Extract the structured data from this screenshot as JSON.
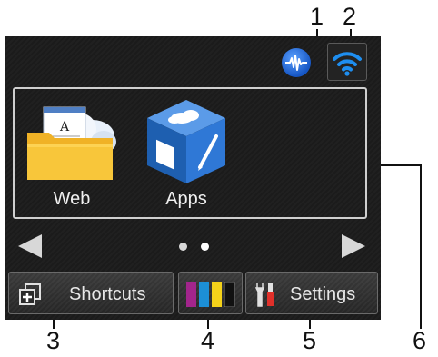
{
  "callouts": [
    "1",
    "2",
    "3",
    "4",
    "5",
    "6"
  ],
  "status_bar": {
    "wired_icon": "wired-lan-icon",
    "wifi_icon": "wifi-icon"
  },
  "apps": [
    {
      "label": "Web",
      "icon": "web-folder-cloud-icon"
    },
    {
      "label": "Apps",
      "icon": "apps-cube-icon"
    }
  ],
  "pager": {
    "pages": 2,
    "current": 2
  },
  "buttons": {
    "shortcuts_label": "Shortcuts",
    "ink_icon": "ink-cartridges-icon",
    "settings_label": "Settings"
  },
  "colors": {
    "ink": [
      "#a3258c",
      "#1c8fd6",
      "#f4d21a",
      "#111111"
    ],
    "accent_blue": "#1f6fe0"
  }
}
